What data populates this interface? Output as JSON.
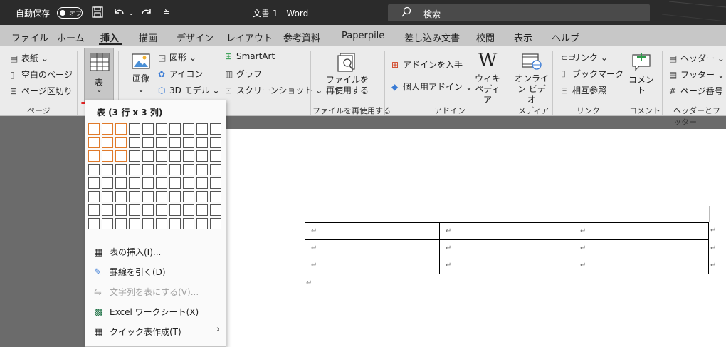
{
  "titlebar": {
    "autosave_label": "自動保存",
    "toggle_text": "オフ",
    "title": "文書 1  -  Word",
    "search_placeholder": "検索"
  },
  "tabs": [
    "ファイル",
    "ホーム",
    "挿入",
    "描画",
    "デザイン",
    "レイアウト",
    "参考資料",
    "Paperpile",
    "差し込み文書",
    "校閲",
    "表示",
    "ヘルプ"
  ],
  "active_tab": "挿入",
  "ribbon": {
    "page_group": {
      "cover": "表紙",
      "blank": "空白のページ",
      "break": "ページ区切り",
      "label": "ページ"
    },
    "table_button": "表",
    "image_button": "画像",
    "illustrations": {
      "shapes": "図形",
      "icons": "アイコン",
      "model3d": "3D モデル",
      "smartart": "SmartArt",
      "graph": "グラフ",
      "screenshot": "スクリーンショット"
    },
    "reuse": {
      "button_line1": "ファイルを",
      "button_line2": "再使用する",
      "label": "ファイルを再使用する"
    },
    "addins": {
      "get": "アドインを入手",
      "personal": "個人用アドイン",
      "wiki_line1": "ウィキ",
      "wiki_line2": "ペディア",
      "label": "アドイン"
    },
    "media": {
      "online_line1": "オンライ",
      "online_line2": "ン ビデオ",
      "label": "メディア"
    },
    "links": {
      "link": "リンク",
      "bookmark": "ブックマーク",
      "crossref": "相互参照",
      "label": "リンク"
    },
    "comment": {
      "button": "コメント",
      "label": "コメント"
    },
    "headerfooter": {
      "header": "ヘッダー",
      "footer": "フッター",
      "pagenum": "ページ番号",
      "label": "ヘッダーとフッター"
    }
  },
  "dropdown": {
    "header": "表 (3 行 x 3 列)",
    "grid_rows": 8,
    "grid_cols": 10,
    "selected_rows": 3,
    "selected_cols": 3,
    "items": [
      {
        "label": "表の挿入(I)...",
        "icon": "table-icon",
        "disabled": false
      },
      {
        "label": "罫線を引く(D)",
        "icon": "draw-table-icon",
        "disabled": false
      },
      {
        "label": "文字列を表にする(V)...",
        "icon": "convert-text-icon",
        "disabled": true
      },
      {
        "label": "Excel ワークシート(X)",
        "icon": "excel-icon",
        "disabled": false
      },
      {
        "label": "クイック表作成(T)",
        "icon": "quick-table-icon",
        "disabled": false
      }
    ]
  },
  "document": {
    "table_rows": 3,
    "table_cols": 3,
    "cell_mark": "↵"
  }
}
